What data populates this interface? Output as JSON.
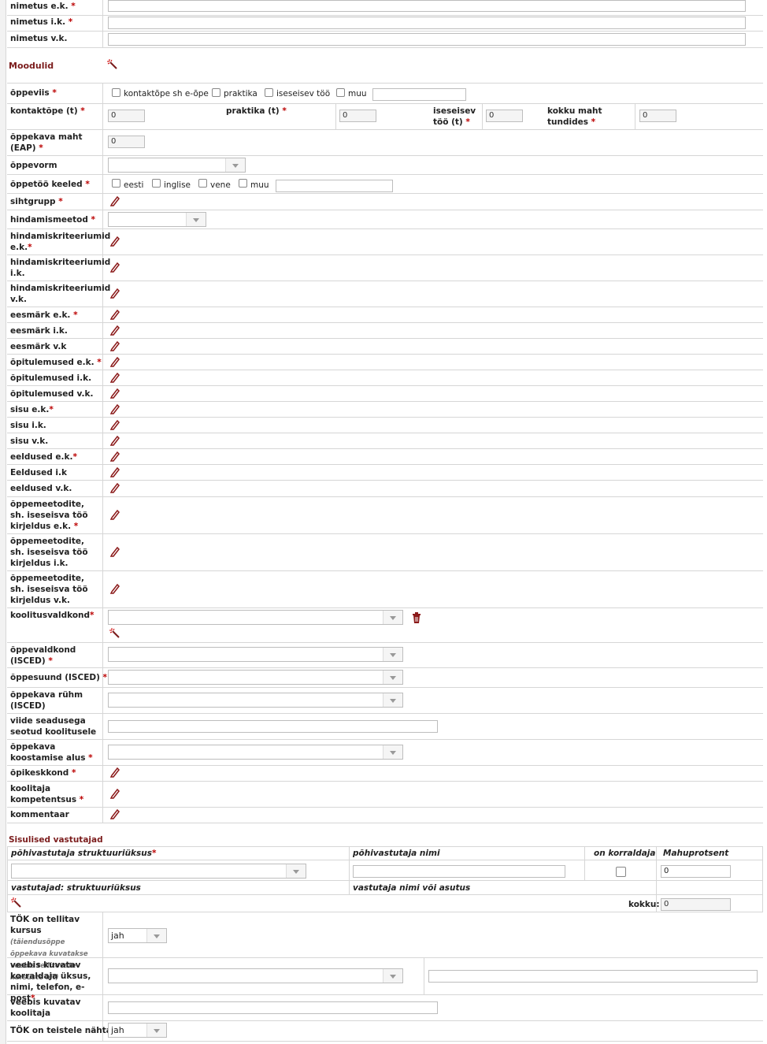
{
  "fields": {
    "name_est": "nimetus e.k.",
    "name_eng": "nimetus i.k.",
    "name_rus": "nimetus v.k."
  },
  "moodulid": {
    "title": "Moodulid",
    "icon": "magic-wand-icon"
  },
  "oppeviis": {
    "label": "õppeviis",
    "options": [
      "kontaktõpe sh e-õpe",
      "praktika",
      "iseseisev töö",
      "muu"
    ]
  },
  "hours": {
    "kontaktope": "kontaktõpe (t)",
    "praktika": "praktika (t)",
    "iseseisev": "iseseisev töö (t)",
    "kokku": "kokku maht tundides",
    "kontaktope_value": "0",
    "praktika_value": "0",
    "iseseisev_value": "0",
    "kokku_value": "0"
  },
  "maht": {
    "label": "õppekava maht (EAP)",
    "value": "0"
  },
  "oppevorm": {
    "label": "õppevorm"
  },
  "keeled": {
    "label": "õppetöö keeled",
    "options": [
      "eesti",
      "inglise",
      "vene",
      "muu"
    ]
  },
  "rows": {
    "sihtgrupp": "sihtgrupp",
    "hindamismeetod": "hindamismeetod",
    "hk_ek": "hindamiskriteeriumid e.k.",
    "hk_ik": "hindamiskriteeriumid i.k.",
    "hk_vk": "hindamiskriteeriumid v.k.",
    "eesmark_ek": "eesmärk e.k.",
    "eesmark_ik": "eesmärk i.k.",
    "eesmark_vk": "eesmärk v.k",
    "opi_ek": "õpitulemused e.k.",
    "opi_ik": "õpitulemused i.k.",
    "opi_vk": "õpitulemused v.k.",
    "sisu_ek": "sisu e.k.",
    "sisu_ik": "sisu i.k.",
    "sisu_vk": "sisu v.k.",
    "eeldused_ek": "eeldused e.k.",
    "eeldused_ik": "Eeldused i.k",
    "eeldused_vk": "eeldused v.k.",
    "om_ek": "õppemeetodite, sh. iseseisva töö kirjeldus e.k.",
    "om_ik": "õppemeetodite, sh. iseseisva töö kirjeldus i.k.",
    "om_vk": "õppemeetodite, sh. iseseisva töö kirjeldus v.k.",
    "koolitusvaldkond": "koolitusvaldkond",
    "oppevaldkond": "õppevaldkond (ISCED)",
    "oppesuund": "õppesuund (ISCED)",
    "opperuhm": "õppekava rühm (ISCED)",
    "viide": "viide seadusega seotud koolitusele",
    "alus": "õppekava koostamise alus",
    "opikeskkond": "õpikeskkond",
    "kompetentsus": "koolitaja kompetentsus",
    "kommentaar": "kommentaar"
  },
  "vastutajad": {
    "title": "Sisulised vastutajad",
    "col1": "põhivastutaja struktuuriüksus",
    "col2": "põhivastutaja nimi",
    "col3": "on korraldaja",
    "col4": "Mahuprotsent",
    "mahu_value": "0",
    "sub1": "vastutajad: struktuuriüksus",
    "sub2": "vastutaja nimi või asutus",
    "kokku": "kokku:",
    "kokku_value": "0"
  },
  "tok": {
    "label": "TÖK on tellitav kursus",
    "note": "(täiendusõppe õppekava kuvatakse veebis tellitovate kursuste alt)",
    "value": "jah"
  },
  "korraldaja": {
    "label": "veebis kuvatav korraldaja üksus, nimi, telefon, e-post"
  },
  "koolitaja": {
    "label": "veebis kuvatav koolitaja"
  },
  "nahtav": {
    "label": "TÖK on teistele nähtav",
    "value": "jah"
  }
}
